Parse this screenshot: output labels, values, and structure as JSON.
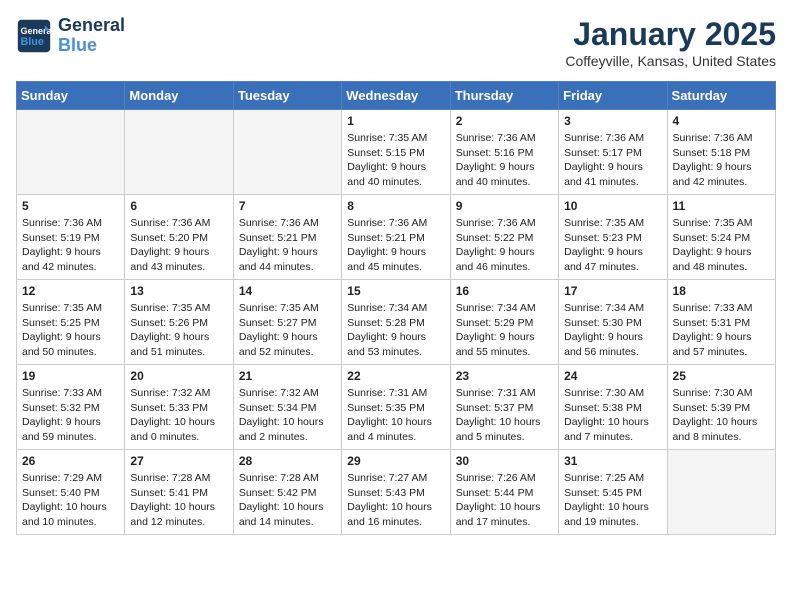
{
  "header": {
    "logo_line1": "General",
    "logo_line2": "Blue",
    "title": "January 2025",
    "subtitle": "Coffeyville, Kansas, United States"
  },
  "days_of_week": [
    "Sunday",
    "Monday",
    "Tuesday",
    "Wednesday",
    "Thursday",
    "Friday",
    "Saturday"
  ],
  "weeks": [
    [
      {
        "day": "",
        "info": ""
      },
      {
        "day": "",
        "info": ""
      },
      {
        "day": "",
        "info": ""
      },
      {
        "day": "1",
        "info": "Sunrise: 7:35 AM\nSunset: 5:15 PM\nDaylight: 9 hours\nand 40 minutes."
      },
      {
        "day": "2",
        "info": "Sunrise: 7:36 AM\nSunset: 5:16 PM\nDaylight: 9 hours\nand 40 minutes."
      },
      {
        "day": "3",
        "info": "Sunrise: 7:36 AM\nSunset: 5:17 PM\nDaylight: 9 hours\nand 41 minutes."
      },
      {
        "day": "4",
        "info": "Sunrise: 7:36 AM\nSunset: 5:18 PM\nDaylight: 9 hours\nand 42 minutes."
      }
    ],
    [
      {
        "day": "5",
        "info": "Sunrise: 7:36 AM\nSunset: 5:19 PM\nDaylight: 9 hours\nand 42 minutes."
      },
      {
        "day": "6",
        "info": "Sunrise: 7:36 AM\nSunset: 5:20 PM\nDaylight: 9 hours\nand 43 minutes."
      },
      {
        "day": "7",
        "info": "Sunrise: 7:36 AM\nSunset: 5:21 PM\nDaylight: 9 hours\nand 44 minutes."
      },
      {
        "day": "8",
        "info": "Sunrise: 7:36 AM\nSunset: 5:21 PM\nDaylight: 9 hours\nand 45 minutes."
      },
      {
        "day": "9",
        "info": "Sunrise: 7:36 AM\nSunset: 5:22 PM\nDaylight: 9 hours\nand 46 minutes."
      },
      {
        "day": "10",
        "info": "Sunrise: 7:35 AM\nSunset: 5:23 PM\nDaylight: 9 hours\nand 47 minutes."
      },
      {
        "day": "11",
        "info": "Sunrise: 7:35 AM\nSunset: 5:24 PM\nDaylight: 9 hours\nand 48 minutes."
      }
    ],
    [
      {
        "day": "12",
        "info": "Sunrise: 7:35 AM\nSunset: 5:25 PM\nDaylight: 9 hours\nand 50 minutes."
      },
      {
        "day": "13",
        "info": "Sunrise: 7:35 AM\nSunset: 5:26 PM\nDaylight: 9 hours\nand 51 minutes."
      },
      {
        "day": "14",
        "info": "Sunrise: 7:35 AM\nSunset: 5:27 PM\nDaylight: 9 hours\nand 52 minutes."
      },
      {
        "day": "15",
        "info": "Sunrise: 7:34 AM\nSunset: 5:28 PM\nDaylight: 9 hours\nand 53 minutes."
      },
      {
        "day": "16",
        "info": "Sunrise: 7:34 AM\nSunset: 5:29 PM\nDaylight: 9 hours\nand 55 minutes."
      },
      {
        "day": "17",
        "info": "Sunrise: 7:34 AM\nSunset: 5:30 PM\nDaylight: 9 hours\nand 56 minutes."
      },
      {
        "day": "18",
        "info": "Sunrise: 7:33 AM\nSunset: 5:31 PM\nDaylight: 9 hours\nand 57 minutes."
      }
    ],
    [
      {
        "day": "19",
        "info": "Sunrise: 7:33 AM\nSunset: 5:32 PM\nDaylight: 9 hours\nand 59 minutes."
      },
      {
        "day": "20",
        "info": "Sunrise: 7:32 AM\nSunset: 5:33 PM\nDaylight: 10 hours\nand 0 minutes."
      },
      {
        "day": "21",
        "info": "Sunrise: 7:32 AM\nSunset: 5:34 PM\nDaylight: 10 hours\nand 2 minutes."
      },
      {
        "day": "22",
        "info": "Sunrise: 7:31 AM\nSunset: 5:35 PM\nDaylight: 10 hours\nand 4 minutes."
      },
      {
        "day": "23",
        "info": "Sunrise: 7:31 AM\nSunset: 5:37 PM\nDaylight: 10 hours\nand 5 minutes."
      },
      {
        "day": "24",
        "info": "Sunrise: 7:30 AM\nSunset: 5:38 PM\nDaylight: 10 hours\nand 7 minutes."
      },
      {
        "day": "25",
        "info": "Sunrise: 7:30 AM\nSunset: 5:39 PM\nDaylight: 10 hours\nand 8 minutes."
      }
    ],
    [
      {
        "day": "26",
        "info": "Sunrise: 7:29 AM\nSunset: 5:40 PM\nDaylight: 10 hours\nand 10 minutes."
      },
      {
        "day": "27",
        "info": "Sunrise: 7:28 AM\nSunset: 5:41 PM\nDaylight: 10 hours\nand 12 minutes."
      },
      {
        "day": "28",
        "info": "Sunrise: 7:28 AM\nSunset: 5:42 PM\nDaylight: 10 hours\nand 14 minutes."
      },
      {
        "day": "29",
        "info": "Sunrise: 7:27 AM\nSunset: 5:43 PM\nDaylight: 10 hours\nand 16 minutes."
      },
      {
        "day": "30",
        "info": "Sunrise: 7:26 AM\nSunset: 5:44 PM\nDaylight: 10 hours\nand 17 minutes."
      },
      {
        "day": "31",
        "info": "Sunrise: 7:25 AM\nSunset: 5:45 PM\nDaylight: 10 hours\nand 19 minutes."
      },
      {
        "day": "",
        "info": ""
      }
    ]
  ]
}
